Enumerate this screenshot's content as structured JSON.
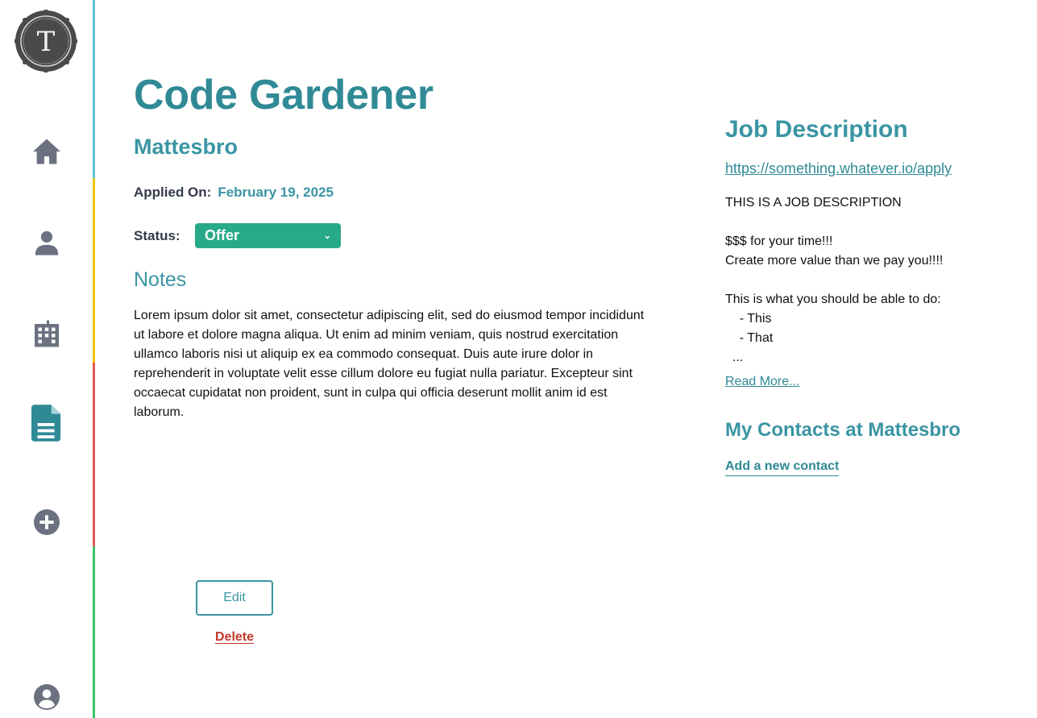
{
  "sidebar": {
    "logo_letter": "T",
    "items": [
      {
        "name": "home-icon"
      },
      {
        "name": "person-icon"
      },
      {
        "name": "building-icon"
      },
      {
        "name": "document-icon"
      },
      {
        "name": "add-circle-icon"
      },
      {
        "name": "account-circle-icon"
      }
    ],
    "colors": {
      "icon": "#6b7180",
      "active_icon": "#2f8a96",
      "segments": [
        "#5bc4d4",
        "#f1c40f",
        "#e05a5a",
        "#3cc46b"
      ]
    }
  },
  "job": {
    "title": "Code Gardener",
    "company": "Mattesbro",
    "applied_label": "Applied On:",
    "applied_date": "February 19, 2025",
    "status_label": "Status:",
    "status_value": "Offer",
    "notes_heading": "Notes",
    "notes": "Lorem ipsum dolor sit amet, consectetur adipiscing elit, sed do eiusmod tempor incididunt ut labore et dolore magna aliqua. Ut enim ad minim veniam, quis nostrud exercitation ullamco laboris nisi ut aliquip ex ea commodo consequat. Duis aute irure dolor in reprehenderit in voluptate velit esse cillum dolore eu fugiat nulla pariatur. Excepteur sint occaecat cupidatat non proident, sunt in culpa qui officia deserunt mollit anim id est laborum.",
    "edit_label": "Edit",
    "delete_label": "Delete"
  },
  "description": {
    "heading": "Job Description",
    "url": "https://something.whatever.io/apply",
    "body": "THIS IS A JOB DESCRIPTION\n\n$$$ for your time!!!\nCreate more value than we pay you!!!!\n\nThis is what you should be able to do:\n    - This\n    - That\n  ...",
    "read_more": "Read More...",
    "contacts_heading": "My Contacts at Mattesbro",
    "add_contact": "Add a new contact"
  },
  "colors": {
    "accent": "#3a95a3",
    "status_green": "#28a98a",
    "danger": "#c0392b"
  }
}
